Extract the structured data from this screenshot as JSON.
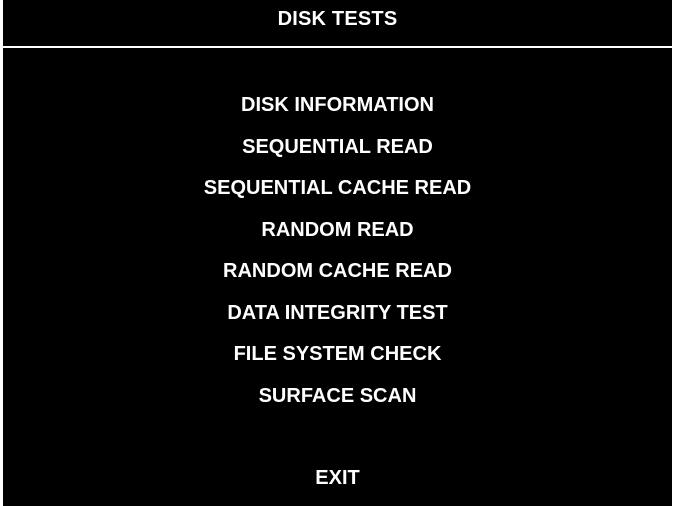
{
  "header": {
    "title": "DISK TESTS"
  },
  "menu": {
    "items": [
      {
        "label": "DISK INFORMATION"
      },
      {
        "label": "SEQUENTIAL READ"
      },
      {
        "label": "SEQUENTIAL CACHE READ"
      },
      {
        "label": "RANDOM READ"
      },
      {
        "label": "RANDOM CACHE READ"
      },
      {
        "label": "DATA INTEGRITY TEST"
      },
      {
        "label": "FILE SYSTEM CHECK"
      },
      {
        "label": "SURFACE SCAN"
      }
    ],
    "exit_label": "EXIT"
  },
  "colors": {
    "background": "#000000",
    "text": "#ffffff"
  }
}
